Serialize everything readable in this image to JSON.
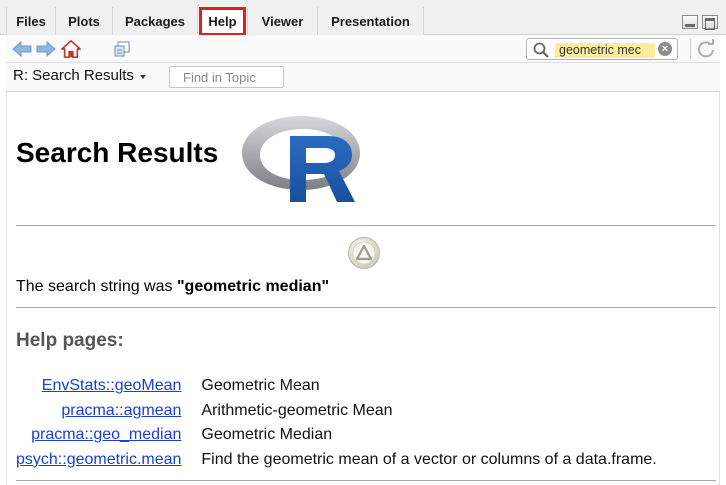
{
  "tabs": [
    {
      "label": "Files"
    },
    {
      "label": "Plots"
    },
    {
      "label": "Packages"
    },
    {
      "label": "Help"
    },
    {
      "label": "Viewer"
    },
    {
      "label": "Presentation"
    }
  ],
  "toolbar": {
    "search_value": "geometric mec",
    "clear_label": "×"
  },
  "subbar": {
    "topic": "R: Search Results",
    "find_placeholder": "Find in Topic"
  },
  "content": {
    "title": "Search Results",
    "search_string_prefix": "The search string was ",
    "search_string_value": "\"geometric median\"",
    "section_heading": "Help pages:",
    "results": [
      {
        "link": "EnvStats::geoMean",
        "description": "Geometric Mean"
      },
      {
        "link": "pracma::agmean",
        "description": "Arithmetic-geometric Mean"
      },
      {
        "link": "pracma::geo_median",
        "description": "Geometric Median"
      },
      {
        "link": "psych::geometric.mean",
        "description": "Find the geometric mean of a vector or columns of a data.frame."
      }
    ]
  },
  "icons": {
    "back": "arrow-left-icon",
    "forward": "arrow-right-icon",
    "home": "home-icon",
    "print": "print-icon",
    "search": "search-icon",
    "refresh": "refresh-icon",
    "up": "up-arrow-icon"
  },
  "colors": {
    "help_highlight": "#e02020",
    "link": "#1a3fd1",
    "search_highlight": "#fbee9a",
    "r_logo_blue": "#1f5fb4"
  }
}
